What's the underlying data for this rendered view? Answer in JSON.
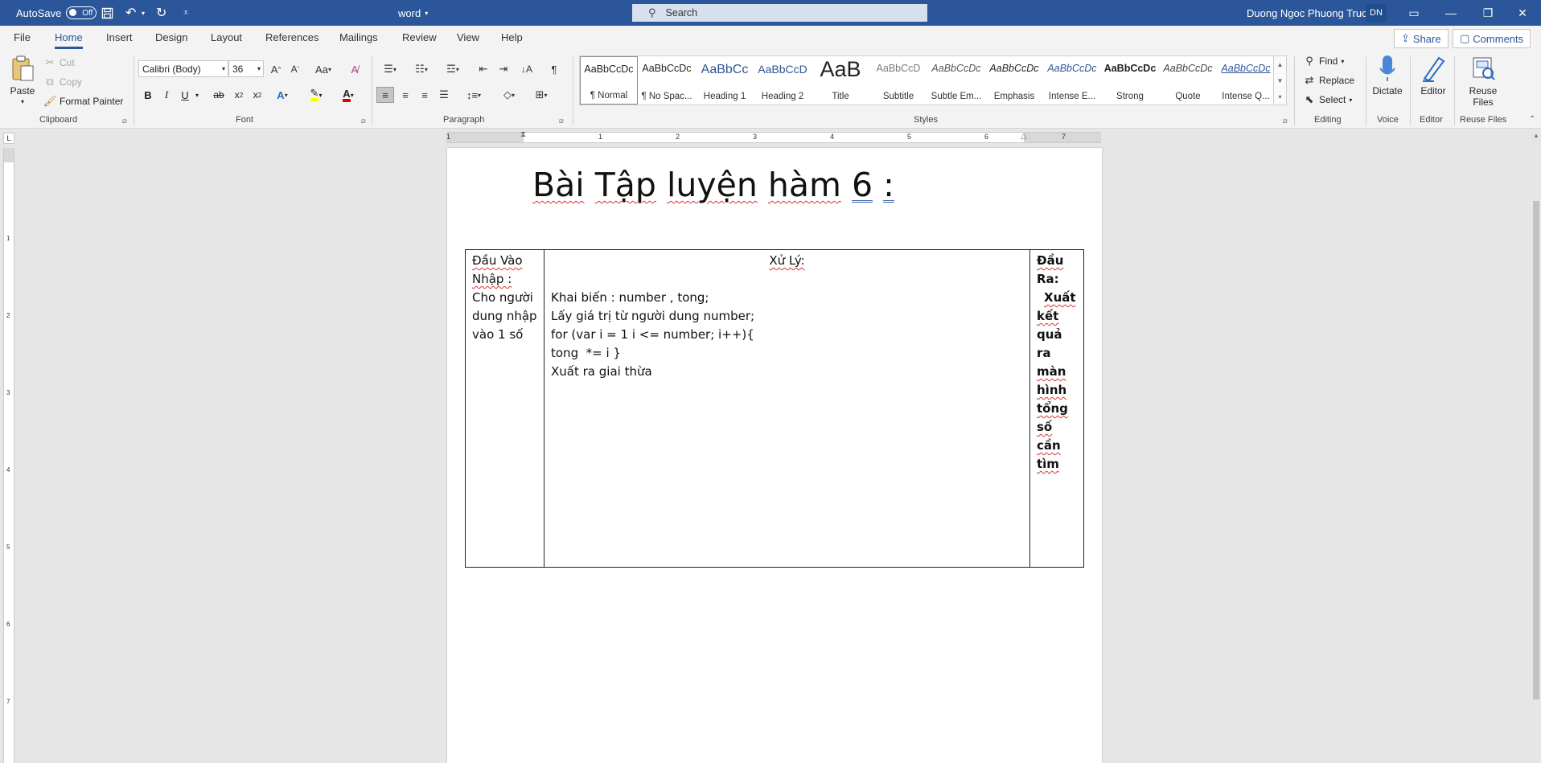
{
  "titlebar": {
    "autosave_label": "AutoSave",
    "autosave_state": "Off",
    "doc_name": "word",
    "search_placeholder": "Search",
    "user_name": "Duong Ngoc Phuong Truc",
    "user_initials": "DN"
  },
  "ribbon_tabs": [
    "File",
    "Home",
    "Insert",
    "Design",
    "Layout",
    "References",
    "Mailings",
    "Review",
    "View",
    "Help"
  ],
  "active_tab": "Home",
  "share_label": "Share",
  "comments_label": "Comments",
  "clipboard": {
    "paste": "Paste",
    "cut": "Cut",
    "copy": "Copy",
    "format_painter": "Format Painter",
    "group": "Clipboard"
  },
  "font": {
    "name": "Calibri (Body)",
    "size": "36",
    "group": "Font"
  },
  "paragraph": {
    "group": "Paragraph"
  },
  "styles": {
    "group": "Styles",
    "items": [
      {
        "preview": "AaBbCcDc",
        "name": "¶ Normal"
      },
      {
        "preview": "AaBbCcDc",
        "name": "¶ No Spac..."
      },
      {
        "preview": "AaBbCc",
        "name": "Heading 1"
      },
      {
        "preview": "AaBbCcD",
        "name": "Heading 2"
      },
      {
        "preview": "AaB",
        "name": "Title"
      },
      {
        "preview": "AaBbCcD",
        "name": "Subtitle"
      },
      {
        "preview": "AaBbCcDc",
        "name": "Subtle Em..."
      },
      {
        "preview": "AaBbCcDc",
        "name": "Emphasis"
      },
      {
        "preview": "AaBbCcDc",
        "name": "Intense E..."
      },
      {
        "preview": "AaBbCcDc",
        "name": "Strong"
      },
      {
        "preview": "AaBbCcDc",
        "name": "Quote"
      },
      {
        "preview": "AaBbCcDc",
        "name": "Intense Q..."
      }
    ]
  },
  "editing": {
    "find": "Find",
    "replace": "Replace",
    "select": "Select",
    "group": "Editing"
  },
  "voice": {
    "dictate": "Dictate",
    "group": "Voice"
  },
  "editor": {
    "label": "Editor",
    "group": "Editor"
  },
  "reuse": {
    "label_line1": "Reuse",
    "label_line2": "Files",
    "group": "Reuse Files"
  },
  "ruler": {
    "h_numbers": [
      "1",
      "1",
      "2",
      "3",
      "4",
      "5",
      "6",
      "7"
    ],
    "v_numbers": [
      "1",
      "2",
      "3",
      "4",
      "5",
      "6",
      "7"
    ]
  },
  "document": {
    "title_words": [
      "Bài",
      "Tập",
      "luyện",
      "hàm",
      "6",
      ":"
    ],
    "col1": {
      "lines": [
        "Đầu Vào",
        "Nhập :",
        "Cho người",
        "dung nhập",
        "vào 1 số"
      ]
    },
    "col2": {
      "header": "Xử Lý:",
      "lines": [
        "Khai biến : number , tong;",
        "Lấy giá trị từ người dung number;",
        "for (var i = 1 i <= number; i++){",
        "tong  *= i }",
        "Xuất ra giai thừa"
      ]
    },
    "col3": {
      "lines": [
        "Đầu",
        "Ra:",
        "Xuất",
        "kết",
        "quả ra",
        "màn",
        "hình",
        "tổng",
        "số cần",
        "tìm"
      ]
    }
  }
}
